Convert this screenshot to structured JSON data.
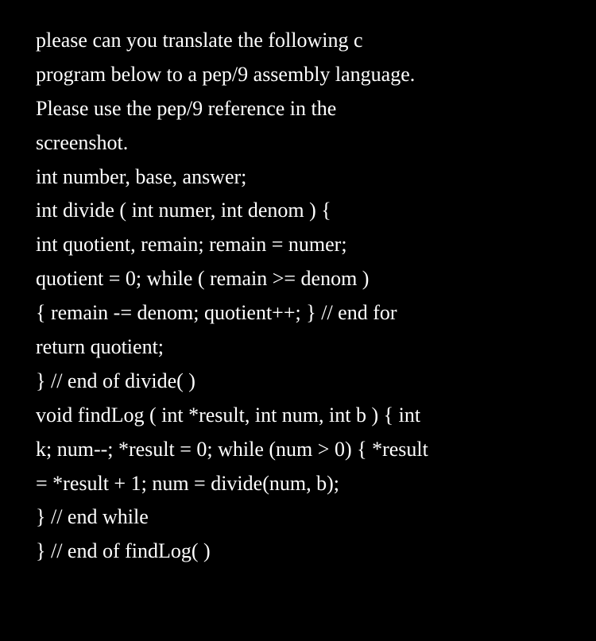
{
  "lines": [
    "please can you translate the following c",
    "program below to a pep/9 assembly language.",
    "Please use the pep/9 reference in the",
    "screenshot.",
    "int number, base, answer;",
    "int divide ( int numer, int denom ) {",
    "int quotient, remain; remain = numer;",
    "quotient = 0; while ( remain >= denom )",
    "{ remain -= denom; quotient++; } // end for",
    "return quotient;",
    "} // end of divide( )",
    "void findLog ( int *result, int num, int b ) { int",
    "k; num--; *result = 0; while (num > 0) { *result",
    "= *result + 1; num = divide(num, b);",
    "} // end while",
    "} // end of findLog( )"
  ]
}
